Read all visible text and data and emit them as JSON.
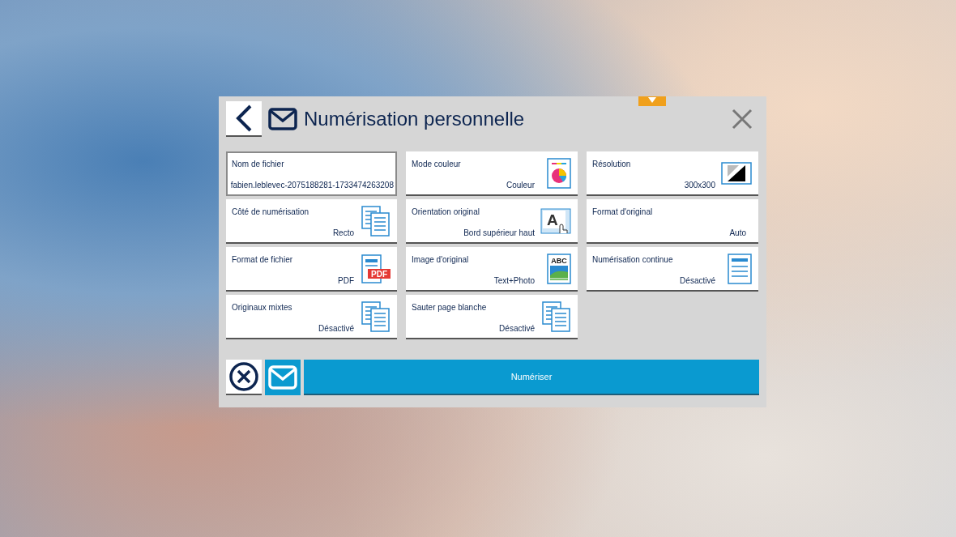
{
  "header": {
    "title": "Numérisation personnelle"
  },
  "settings": [
    {
      "label": "Nom de fichier",
      "value": "fabien.leblevec-2075188281-1733474263208",
      "kind": "text",
      "selected": true
    },
    {
      "label": "Mode couleur",
      "value": "Couleur",
      "kind": "color",
      "selected": false
    },
    {
      "label": "Résolution",
      "value": "300x300",
      "kind": "resolution",
      "selected": false
    },
    {
      "label": "Côté de numérisation",
      "value": "Recto",
      "kind": "pages",
      "selected": false
    },
    {
      "label": "Orientation original",
      "value": "Bord supérieur haut",
      "kind": "orientation",
      "selected": false,
      "badge": "A"
    },
    {
      "label": "Format d'original",
      "value": "Auto",
      "kind": "plain",
      "selected": false
    },
    {
      "label": "Format de fichier",
      "value": "PDF",
      "kind": "pdf",
      "selected": false,
      "badge": "PDF"
    },
    {
      "label": "Image d'original",
      "value": "Text+Photo",
      "kind": "photo",
      "selected": false,
      "badge": "ABC"
    },
    {
      "label": "Numérisation continue",
      "value": "Désactivé",
      "kind": "single",
      "selected": false
    },
    {
      "label": "Originaux mixtes",
      "value": "Désactivé",
      "kind": "pages",
      "selected": false
    },
    {
      "label": "Sauter page blanche",
      "value": "Désactivé",
      "kind": "pages",
      "selected": false
    }
  ],
  "footer": {
    "scan_button": "Numériser"
  }
}
